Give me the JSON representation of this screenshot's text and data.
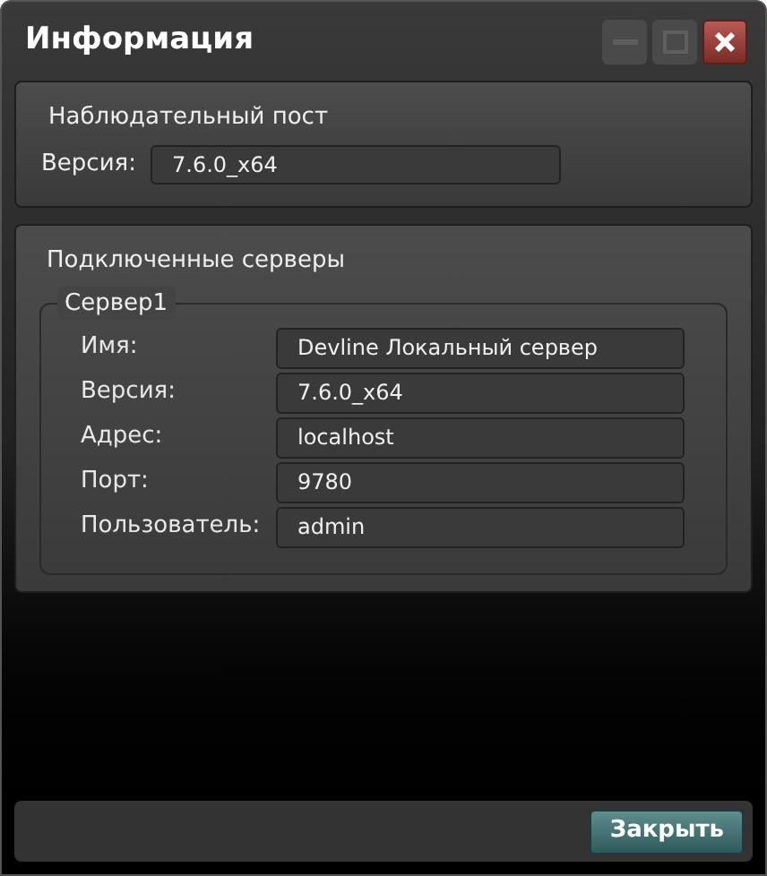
{
  "window": {
    "title": "Информация"
  },
  "station": {
    "title": "Наблюдательный пост",
    "label": "Версия:",
    "value": "7.6.0_x64"
  },
  "servers": {
    "title": "Подключенные серверы",
    "groups": [
      {
        "name": "Сервер1",
        "fields": [
          {
            "label": "Имя:",
            "value": "Devline Локальный сервер"
          },
          {
            "label": "Версия:",
            "value": "7.6.0_x64"
          },
          {
            "label": "Адрес:",
            "value": "localhost"
          },
          {
            "label": "Порт:",
            "value": "9780"
          },
          {
            "label": "Пользователь:",
            "value": "admin"
          }
        ]
      }
    ]
  },
  "buttons": [
    "Закрыть"
  ]
}
